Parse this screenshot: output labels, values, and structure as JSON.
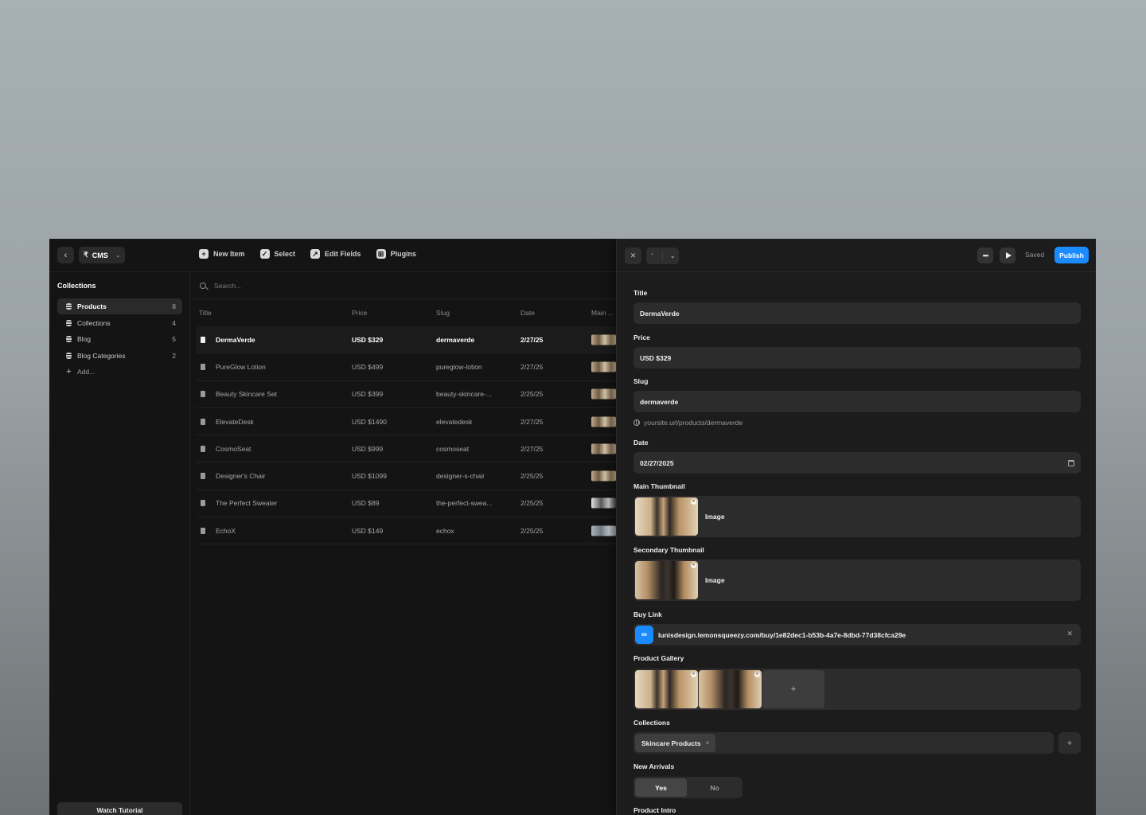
{
  "cms": {
    "switcher_label": "CMS",
    "toolbar": {
      "new_item": "New Item",
      "select": "Select",
      "edit_fields": "Edit Fields",
      "plugins": "Plugins"
    },
    "sidebar": {
      "title": "Collections",
      "items": [
        {
          "label": "Products",
          "count": "8"
        },
        {
          "label": "Collections",
          "count": "4"
        },
        {
          "label": "Blog",
          "count": "5"
        },
        {
          "label": "Blog Categories",
          "count": "2"
        }
      ],
      "add_label": "Add...",
      "watch_tutorial": "Watch Tutorial"
    },
    "search_placeholder": "Search...",
    "columns": {
      "title": "Title",
      "price": "Price",
      "slug": "Slug",
      "date": "Date",
      "main": "Main ..."
    },
    "rows": [
      {
        "title": "DermaVerde",
        "price": "USD $329",
        "slug": "dermaverde",
        "date": "2/27/25"
      },
      {
        "title": "PureGlow Lotion",
        "price": "USD $499",
        "slug": "pureglow-lotion",
        "date": "2/27/25"
      },
      {
        "title": "Beauty Skincare Set",
        "price": "USD $399",
        "slug": "beauty-skincare-...",
        "date": "2/25/25"
      },
      {
        "title": "ElevateDesk",
        "price": "USD $1490",
        "slug": "elevatedesk",
        "date": "2/27/25"
      },
      {
        "title": "CosmoSeat",
        "price": "USD $999",
        "slug": "cosmoseat",
        "date": "2/27/25"
      },
      {
        "title": "Designer's Chair",
        "price": "USD $1099",
        "slug": "designer-s-chair",
        "date": "2/25/25"
      },
      {
        "title": "The Perfect Sweater",
        "price": "USD $89",
        "slug": "the-perfect-swea...",
        "date": "2/25/25"
      },
      {
        "title": "EchoX",
        "price": "USD $149",
        "slug": "echox",
        "date": "2/25/25"
      }
    ]
  },
  "editor": {
    "saved_label": "Saved",
    "publish_label": "Publish",
    "title_label": "Title",
    "title_value": "DermaVerde",
    "price_label": "Price",
    "price_value": "USD $329",
    "slug_label": "Slug",
    "slug_value": "dermaverde",
    "slug_hint": "yoursite.url/products/dermaverde",
    "date_label": "Date",
    "date_value": "02/27/2025",
    "main_thumb_label": "Main Thumbnail",
    "main_thumb_type": "Image",
    "secondary_thumb_label": "Secondary Thumbnail",
    "secondary_thumb_type": "Image",
    "buy_link_label": "Buy Link",
    "buy_link_value": "lunisdesign.lemonsqueezy.com/buy/1e82dec1-b53b-4a7e-8dbd-77d38cfca29e",
    "gallery_label": "Product Gallery",
    "collections_label": "Collections",
    "collection_tag": "Skincare Products",
    "new_arrivals_label": "New Arrivals",
    "yes_label": "Yes",
    "no_label": "No",
    "product_intro_label": "Product Intro"
  },
  "colors": {
    "accent": "#1a8cff",
    "panel": "#1c1c1c",
    "app_bg": "#141414"
  }
}
